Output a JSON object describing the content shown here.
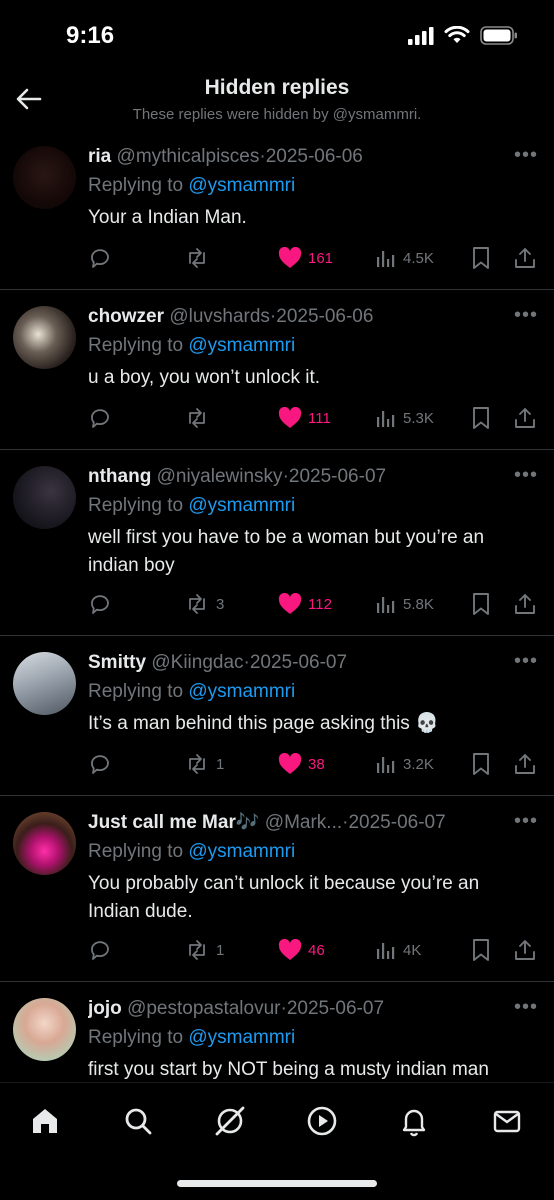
{
  "status_bar": {
    "time": "9:16"
  },
  "header": {
    "title": "Hidden replies",
    "subtitle": "These replies were hidden by @ysmammri."
  },
  "replies": [
    {
      "name": "ria",
      "handle": "@mythicalpisces",
      "date": "2025-06-06",
      "replying_prefix": "Replying to",
      "replying_to": "@ysmammri",
      "text": "Your a Indian Man.",
      "retweets": "",
      "likes": "161",
      "views": "4.5K",
      "replies": ""
    },
    {
      "name": "chowzer",
      "handle": "@luvshards",
      "date": "2025-06-06",
      "replying_prefix": "Replying to",
      "replying_to": "@ysmammri",
      "text": "u a boy, you won’t unlock it.",
      "retweets": "",
      "likes": "111",
      "views": "5.3K",
      "replies": ""
    },
    {
      "name": "nthang",
      "handle": "@niyalewinsky",
      "date": "2025-06-07",
      "replying_prefix": "Replying to",
      "replying_to": "@ysmammri",
      "text": "well first you have to be a woman but you’re an indian boy",
      "retweets": "3",
      "likes": "112",
      "views": "5.8K",
      "replies": ""
    },
    {
      "name": "Smitty",
      "handle": "@Kiingdac",
      "date": "2025-06-07",
      "replying_prefix": "Replying to",
      "replying_to": "@ysmammri",
      "text": "It’s a man behind this page asking this 💀",
      "retweets": "1",
      "likes": "38",
      "views": "3.2K",
      "replies": ""
    },
    {
      "name": "Just call me Mar🎶",
      "handle": "@Mark...",
      "date": "2025-06-07",
      "replying_prefix": "Replying to",
      "replying_to": "@ysmammri",
      "text": "You probably can’t unlock it because you’re an Indian dude.",
      "retweets": "1",
      "likes": "46",
      "views": "4K",
      "replies": ""
    },
    {
      "name": "jojo",
      "handle": "@pestopastalovur",
      "date": "2025-06-07",
      "replying_prefix": "Replying to",
      "replying_to": "@ysmammri",
      "text": "first you start by NOT being a musty indian man",
      "retweets": "",
      "likes": "",
      "views": "",
      "replies": ""
    }
  ],
  "icons": {
    "back": "arrow-left-icon",
    "reply": "speech-bubble-icon",
    "retweet": "retweet-icon",
    "like": "heart-icon",
    "views": "bar-chart-icon",
    "bookmark": "bookmark-icon",
    "share": "share-icon"
  },
  "tabs": [
    "home",
    "search",
    "grok",
    "video",
    "notifications",
    "messages"
  ],
  "colors": {
    "like": "#f91880",
    "mention": "#1d9bf0",
    "muted": "#71767b",
    "text": "#e7e9ea"
  }
}
